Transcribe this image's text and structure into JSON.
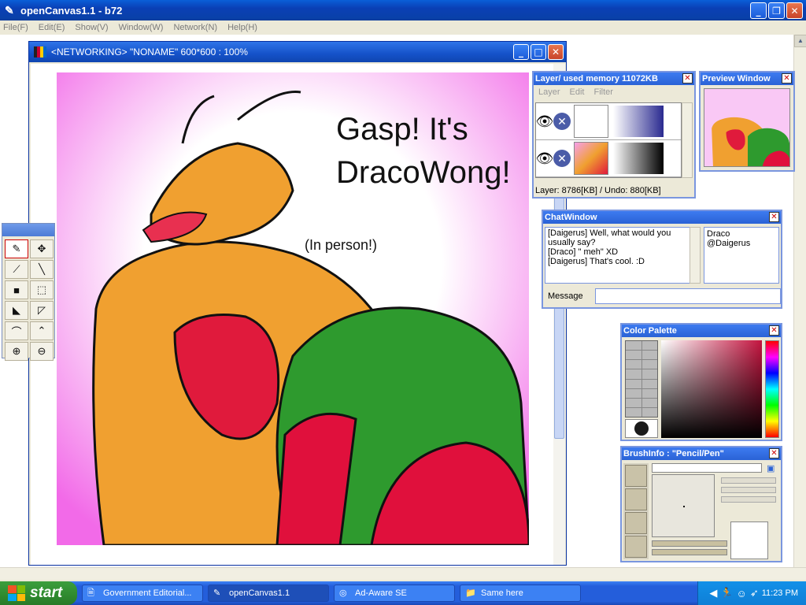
{
  "app": {
    "title": "openCanvas1.1  - b72",
    "minimize_glyph": "_",
    "maximize_glyph": "❐",
    "close_glyph": "✕"
  },
  "menu": [
    "File(F)",
    "Edit(E)",
    "Show(V)",
    "Window(W)",
    "Network(N)",
    "Help(H)"
  ],
  "canvas_window": {
    "title": "<NETWORKING>  \"NONAME\"  600*600 : 100%"
  },
  "artwork": {
    "speech_line1": "Gasp! It's",
    "speech_line2": "DracoWong!",
    "aside": "(In person!)"
  },
  "tools": [
    {
      "name": "pen-tool",
      "glyph": "✎"
    },
    {
      "name": "move-tool",
      "glyph": "✥"
    },
    {
      "name": "eyedropper-tool",
      "glyph": "⟋"
    },
    {
      "name": "line-tool",
      "glyph": "╲"
    },
    {
      "name": "fill-rect-tool",
      "glyph": "■"
    },
    {
      "name": "select-rect-tool",
      "glyph": "⬚"
    },
    {
      "name": "fill-lasso-tool",
      "glyph": "◣"
    },
    {
      "name": "lasso-tool",
      "glyph": "◸"
    },
    {
      "name": "curve-tool",
      "glyph": "⌒"
    },
    {
      "name": "polyline-tool",
      "glyph": "⌃"
    },
    {
      "name": "zoom-in-tool",
      "glyph": "⊕"
    },
    {
      "name": "zoom-out-tool",
      "glyph": "⊖"
    }
  ],
  "layer_panel": {
    "title": "Layer/ used memory 11072KB",
    "menu": [
      "Layer",
      "Edit",
      "Filter"
    ],
    "status": "Layer: 8786[KB] / Undo: 880[KB]",
    "delete_glyph": "✕",
    "eye_glyph": "👁"
  },
  "preview_panel": {
    "title": "Preview Window"
  },
  "chat_panel": {
    "title": "ChatWindow",
    "messages": [
      "[Daigerus] Well, what would you usually say?",
      "[Draco] \" meh\" XD",
      "[Daigerus] That's cool. :D"
    ],
    "users": [
      "Draco",
      "@Daigerus"
    ],
    "message_label": "Message",
    "message_value": ""
  },
  "color_panel": {
    "title": "Color Palette",
    "current_color": "#1a1a1a"
  },
  "brush_panel": {
    "title": "BrushInfo : \"Pencil/Pen\""
  },
  "taskbar": {
    "start": "start",
    "tasks": [
      {
        "label": "Government Editorial...",
        "icon": "🗎",
        "active": false
      },
      {
        "label": "openCanvas1.1",
        "icon": "✎",
        "active": true
      },
      {
        "label": "Ad-Aware SE",
        "icon": "◎",
        "active": false
      },
      {
        "label": "Same here",
        "icon": "📁",
        "active": false
      }
    ],
    "clock": "11:23 PM"
  },
  "colors": {
    "titlebar": "#0a4fc8",
    "taskbar": "#245edb",
    "start": "#2f8a2f",
    "canvas_bg": "#ffffff"
  }
}
